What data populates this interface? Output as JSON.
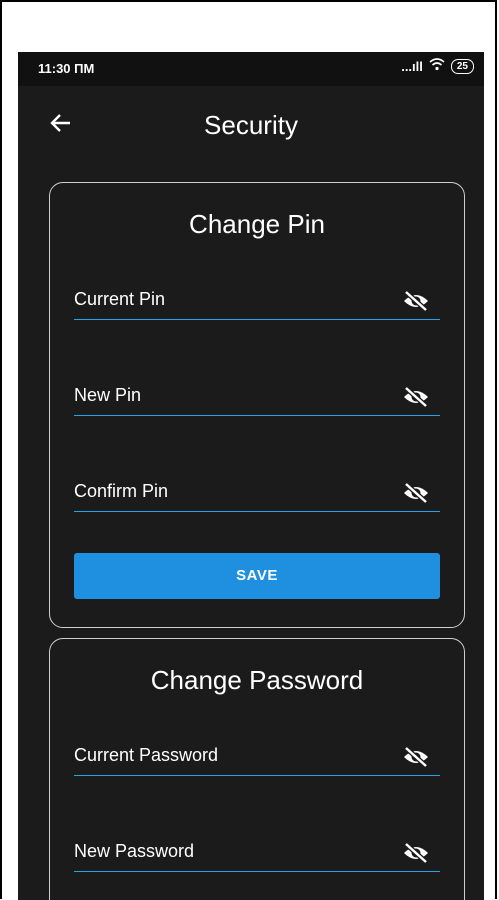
{
  "status_bar": {
    "time": "11:30 ПМ",
    "signal": "...ıll",
    "battery": "25"
  },
  "header": {
    "title": "Security"
  },
  "pin_section": {
    "title": "Change Pin",
    "fields": [
      {
        "label": "Current Pin"
      },
      {
        "label": "New Pin"
      },
      {
        "label": "Confirm Pin"
      }
    ],
    "save_label": "SAVE"
  },
  "password_section": {
    "title": "Change Password",
    "fields": [
      {
        "label": "Current Password"
      },
      {
        "label": "New Password"
      }
    ]
  },
  "colors": {
    "background": "#1b1b1b",
    "accent": "#1f8fe0",
    "underline": "#2aa3e6",
    "text": "#ffffff"
  },
  "icons": {
    "back": "arrow-left-icon",
    "visibility": "eye-off-icon"
  }
}
